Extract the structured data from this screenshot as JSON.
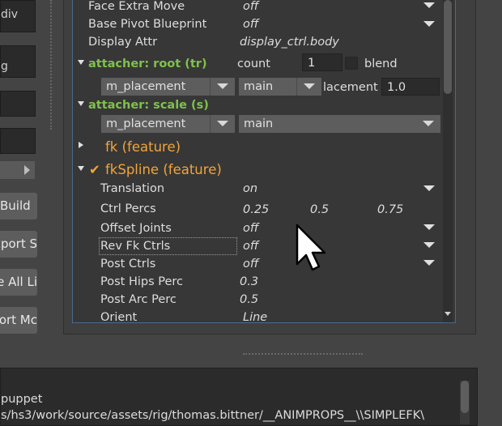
{
  "left_panel": {
    "box_top_text": "div",
    "box_mid_text": "g",
    "buttons": [
      {
        "label": "Build"
      },
      {
        "label": "xport S"
      },
      {
        "label": "e All Li"
      },
      {
        "label": "ort Mc"
      }
    ]
  },
  "attributes": {
    "face_extra_move": {
      "label": "Face Extra Move",
      "value": "off"
    },
    "base_pivot_blueprint": {
      "label": "Base Pivot Blueprint",
      "value": "off"
    },
    "display_attr": {
      "label": "Display Attr",
      "value": "display_ctrl.body"
    }
  },
  "attacher_root": {
    "title": "attacher: root (tr)",
    "count_label": "count",
    "count_value": "1",
    "blend_label": "blend",
    "combo_left": "m_placement",
    "combo_mid": "main",
    "placement_label": "lacement",
    "placement_value": "1.0"
  },
  "attacher_scale": {
    "title": "attacher: scale (s)",
    "combo_left": "m_placement",
    "combo_mid": "main"
  },
  "features": {
    "fk": {
      "label": "fk (feature)"
    },
    "fkspline": {
      "label": "fkSpline (feature)",
      "check": "✔"
    }
  },
  "fkspline_attrs": {
    "translation": {
      "label": "Translation",
      "value": "on"
    },
    "ctrl_percs": {
      "label": "Ctrl Percs",
      "values": [
        "0.25",
        "0.5",
        "0.75"
      ]
    },
    "offset_joints": {
      "label": "Offset Joints",
      "value": "off"
    },
    "rev_fk_ctrls": {
      "label": "Rev Fk Ctrls",
      "value": "off"
    },
    "post_ctrls": {
      "label": "Post Ctrls",
      "value": "off"
    },
    "post_hips_perc": {
      "label": "Post Hips Perc",
      "value": "0.3"
    },
    "post_arc_perc": {
      "label": "Post Arc Perc",
      "value": "0.5"
    },
    "orient": {
      "label": "Orient",
      "value": "Line"
    }
  },
  "console": {
    "line1": "puppet",
    "line2": "s/hs3/work/source/assets/rig/thomas.bittner/__ANIMPROPS__\\\\SIMPLEFK\\"
  },
  "icons": {
    "expand": "triangle-down",
    "collapse": "triangle-right",
    "dropdown": "triangle-down",
    "cursor": "arrow-pointer"
  }
}
